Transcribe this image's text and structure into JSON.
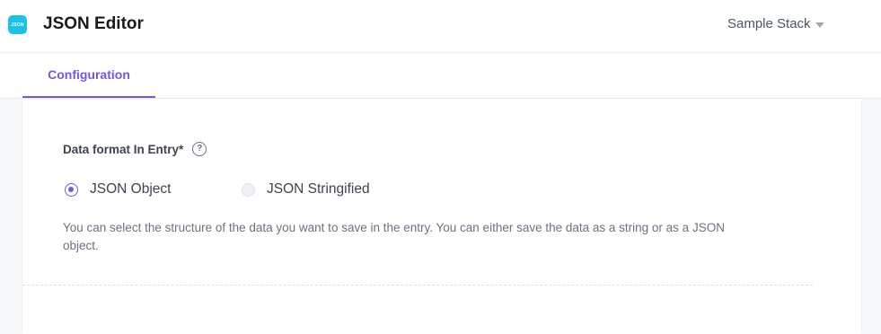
{
  "header": {
    "logo_text": "JSON",
    "app_title": "JSON Editor",
    "stack_name": "Sample Stack"
  },
  "tabs": [
    {
      "label": "Configuration",
      "active": true
    }
  ],
  "config": {
    "field_label": "Data format In Entry*",
    "help_icon_glyph": "?",
    "options": [
      {
        "label": "JSON Object",
        "selected": true
      },
      {
        "label": "JSON Stringified",
        "selected": false
      }
    ],
    "help_text": "You can select the structure of the data you want to save in the entry. You can either save the data as a string or as a JSON object."
  },
  "colors": {
    "accent": "#6c5ce7",
    "logo": "#1dc1e8"
  }
}
